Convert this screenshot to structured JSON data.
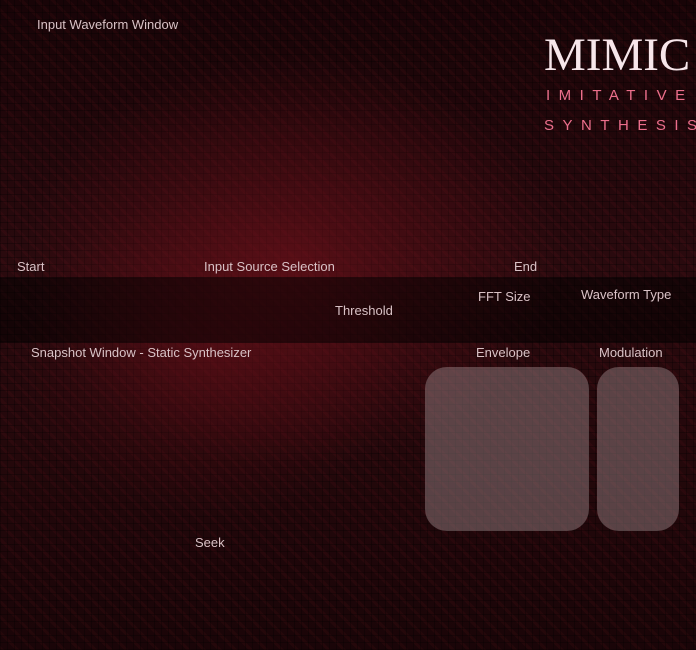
{
  "brand": {
    "title": "MIMIC",
    "subtitle_line1": "IMITATIVE",
    "subtitle_line2": "SYNTHESIS"
  },
  "input_waveform": {
    "label": "Input Waveform Window"
  },
  "controls": {
    "start_label": "Start",
    "input_source_label": "Input Source Selection",
    "end_label": "End",
    "threshold_label": "Threshold",
    "fft_size_label": "FFT Size",
    "waveform_type_label": "Waveform Type"
  },
  "snapshot": {
    "label": "Snapshot Window - Static Synthesizer",
    "seek_label": "Seek"
  },
  "envelope": {
    "label": "Envelope"
  },
  "modulation": {
    "label": "Modulation"
  },
  "colors": {
    "background": "#1b0709",
    "accent_pink": "#ec6f8c",
    "brand_text": "#f7e6ea",
    "label_text": "#d9c2c6",
    "panel_fill": "#a08c8e"
  }
}
